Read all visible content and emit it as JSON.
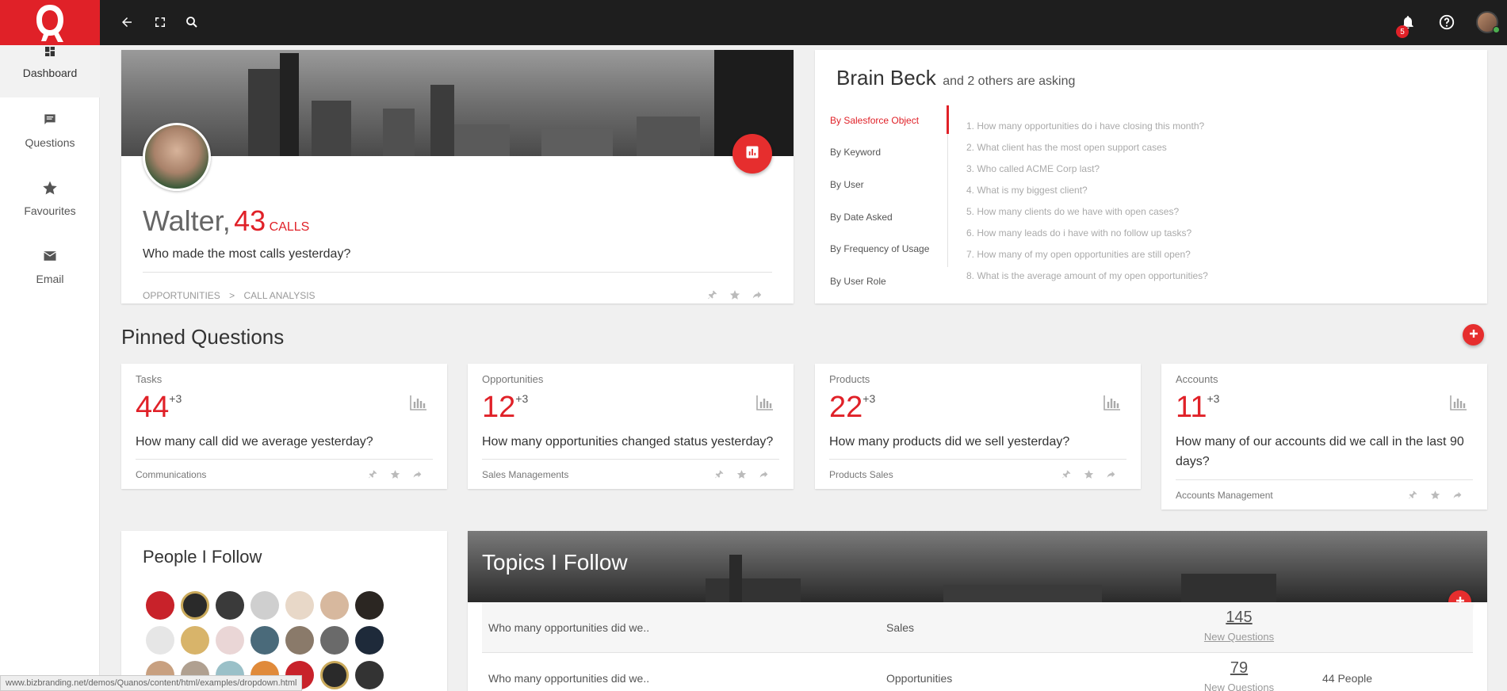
{
  "colors": {
    "accent": "#e02128",
    "topbar": "#1e1e1e"
  },
  "topbar": {
    "notification_count": "5",
    "icons": [
      "back-arrow-icon",
      "fullscreen-icon",
      "search-icon",
      "bell-icon",
      "help-icon"
    ]
  },
  "sidebar": {
    "items": [
      {
        "label": "Dashboard",
        "icon": "dashboard-icon"
      },
      {
        "label": "Questions",
        "icon": "comment-icon"
      },
      {
        "label": "Favourites",
        "icon": "star-icon"
      },
      {
        "label": "Email",
        "icon": "email-icon"
      }
    ]
  },
  "profile": {
    "name": "Walter,",
    "count": "43",
    "unit": "CALLS",
    "question": "Who made the most calls yesterday?",
    "crumb_1": "OPPORTUNITIES",
    "crumb_sep": ">",
    "crumb_2": "CALL ANALYSIS"
  },
  "asking": {
    "name": "Brain Beck",
    "suffix": "and 2 others are asking",
    "filters": [
      "By Salesforce Object",
      "By Keyword",
      "By User",
      "By Date Asked",
      "By Frequency of Usage",
      "By User Role"
    ],
    "questions": [
      "1. How many opportunities do i have closing this month?",
      "2. What client has the most open support cases",
      "3. Who called ACME Corp last?",
      "4. What is my biggest client?",
      "5. How many clients do we have with open cases?",
      "6. How many leads do i have with no follow up tasks?",
      "7. How many of my open opportunities are still open?",
      "8. What is the average amount of my open opportunities?"
    ]
  },
  "pinned": {
    "title": "Pinned Questions",
    "cards": [
      {
        "category": "Tasks",
        "number": "44",
        "delta": "+3",
        "question": "How many call did we average yesterday?",
        "footer": "Communications"
      },
      {
        "category": "Opportunities",
        "number": "12",
        "delta": "+3",
        "question": "How many opportunities changed status yesterday?",
        "footer": "Sales Managements"
      },
      {
        "category": "Products",
        "number": "22",
        "delta": "+3",
        "question": "How many products did we sell yesterday?",
        "footer": "Products Sales"
      },
      {
        "category": "Accounts",
        "number": "11",
        "delta": "+3",
        "question": "How many of our accounts did we call in the last 90 days?",
        "footer": "Accounts Management"
      }
    ]
  },
  "people": {
    "title": "People I Follow"
  },
  "topics": {
    "title": "Topics I Follow",
    "rows": [
      {
        "question": "Who many opportunities did we..",
        "topic": "Sales",
        "count": "145",
        "count_label": "New Questions",
        "people": ""
      },
      {
        "question": "Who many opportunities did we..",
        "topic": "Opportunities",
        "count": "79",
        "count_label": "New Questions",
        "people": "44 People"
      }
    ]
  },
  "statusbar": "www.bizbranding.net/demos/Quanos/content/html/examples/dropdown.html"
}
